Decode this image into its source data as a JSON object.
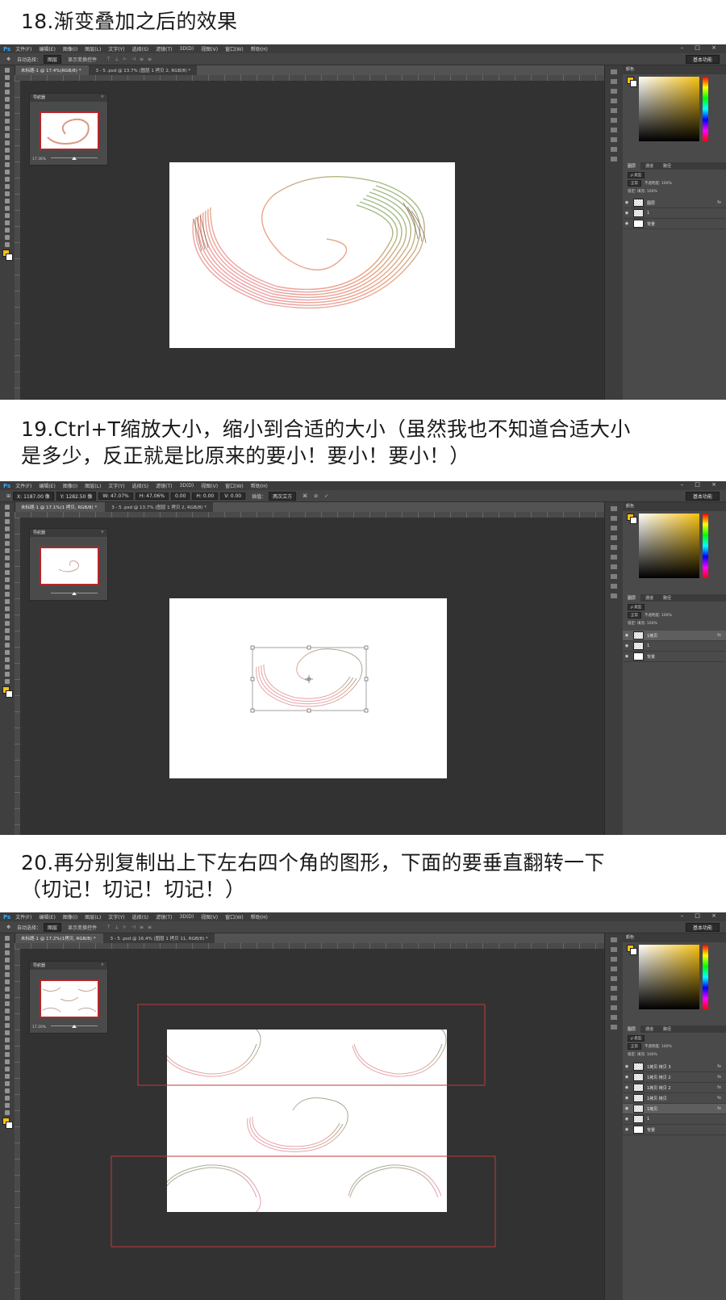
{
  "captions": {
    "s18": "18.渐变叠加之后的效果",
    "s19_l1": "19.Ctrl+T缩放大小，缩小到合适的大小（虽然我也不知道合适大小",
    "s19_l2": "是多少，反正就是比原来的要小！要小！要小！）",
    "s20_l1": "20.再分别复制出上下左右四个角的图形，下面的要垂直翻转一下",
    "s20_l2": "（切记！切记！切记！）"
  },
  "app": {
    "logo": "Ps",
    "menu": [
      "文件(F)",
      "编辑(E)",
      "图像(I)",
      "图层(L)",
      "文字(Y)",
      "选择(S)",
      "滤镜(T)",
      "3D(D)",
      "视图(V)",
      "窗口(W)",
      "帮助(H)"
    ],
    "window_controls": "– □ ×",
    "workspace": "基本功能",
    "options_move": {
      "auto_select": "自动选择：",
      "mode": "图层",
      "transform_controls": "显示变换控件"
    },
    "options_transform": {
      "x": "X: 1187.00 像",
      "y": "Y: 1282.50 像",
      "w": "W: 47.07%",
      "h": "H: 47.06%",
      "angle": "0.00",
      "hskew": "H: 0.00",
      "vskew": "V: 0.00",
      "interp_label": "插值：",
      "interp": "两次立方"
    },
    "navigator_title": "导航器",
    "color_title": "颜色",
    "layer_tabs": [
      "图层",
      "通道",
      "路径"
    ],
    "blend": "正常",
    "opacity": "不透明度: 100%",
    "lock": "锁定:",
    "fill": "填充: 100%",
    "kind": "ρ 类型"
  },
  "panels": [
    {
      "tabs": [
        "未标题-1 @ 17.4%(RGB/8) *",
        "3 - 5 .psd @ 13.7% (图层 1 拷贝 2, RGB/8) *"
      ],
      "zoom": "17.36%",
      "layers": [
        {
          "name": "图层",
          "fx": "fx",
          "selected": false
        },
        {
          "name": "1",
          "fx": "",
          "selected": false
        },
        {
          "name": "背景",
          "fx": "",
          "selected": false
        }
      ]
    },
    {
      "tabs": [
        "未标题-1 @ 17.1%(1 拷贝, RGB/8) *",
        "3 - 5 .psd @ 13.7% (图层 1 拷贝 2, RGB/8) *"
      ],
      "zoom": "",
      "layers": [
        {
          "name": "1拷贝",
          "fx": "fx",
          "selected": true
        },
        {
          "name": "1",
          "fx": "",
          "selected": false
        },
        {
          "name": "背景",
          "fx": "",
          "selected": false
        }
      ]
    },
    {
      "tabs": [
        "未标题-1 @ 17.2%(1拷贝, RGB/8) *",
        "3 - 5 .psd @ 16.4% (图层 1 拷贝 11, RGB/8) *"
      ],
      "zoom": "17.20%",
      "layers": [
        {
          "name": "1拷贝 拷贝 3",
          "fx": "fx",
          "selected": false
        },
        {
          "name": "1拷贝 拷贝 2",
          "fx": "fx",
          "selected": false
        },
        {
          "name": "1拷贝 拷贝 2",
          "fx": "fx",
          "selected": false
        },
        {
          "name": "1拷贝 拷贝",
          "fx": "fx",
          "selected": false
        },
        {
          "name": "1拷贝",
          "fx": "fx",
          "selected": true
        },
        {
          "name": "1",
          "fx": "",
          "selected": false
        },
        {
          "name": "背景",
          "fx": "",
          "selected": false
        }
      ]
    }
  ],
  "colors": {
    "accent": "#f7c113",
    "guide": "#c0393e",
    "ps_blue": "#31a8ff"
  }
}
